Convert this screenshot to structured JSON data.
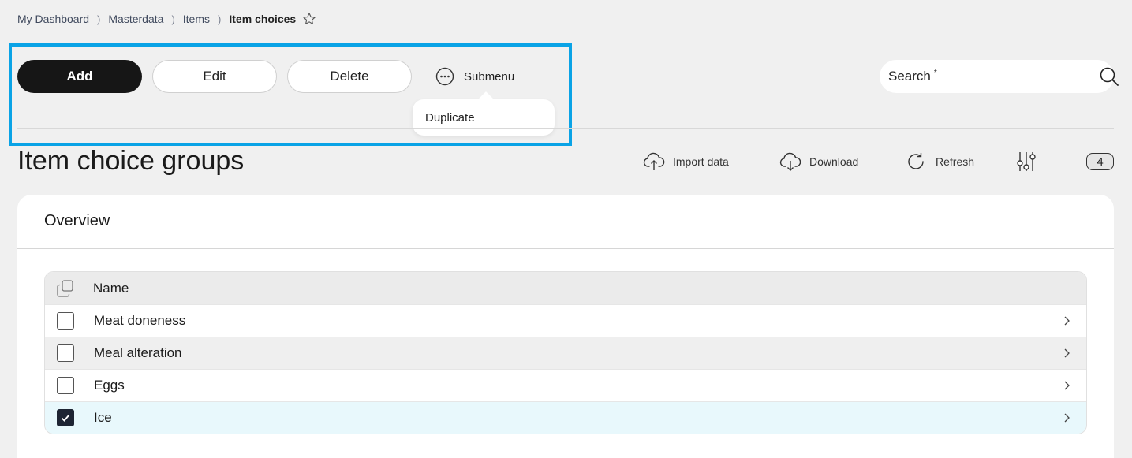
{
  "breadcrumb": {
    "items": [
      "My Dashboard",
      "Masterdata",
      "Items"
    ],
    "current": "Item choices",
    "separator": ")"
  },
  "toolbar": {
    "add_label": "Add",
    "edit_label": "Edit",
    "delete_label": "Delete",
    "submenu_label": "Submenu",
    "submenu_items": [
      "Duplicate"
    ]
  },
  "search": {
    "label": "Search",
    "required_mark": "*",
    "value": ""
  },
  "page": {
    "title": "Item choice groups"
  },
  "actions": {
    "import_label": "Import data",
    "download_label": "Download",
    "refresh_label": "Refresh",
    "count": "4"
  },
  "card": {
    "title": "Overview",
    "table": {
      "header": "Name",
      "rows": [
        {
          "name": "Meat doneness",
          "checked": false
        },
        {
          "name": "Meal alteration",
          "checked": false
        },
        {
          "name": "Eggs",
          "checked": false
        },
        {
          "name": "Ice",
          "checked": true
        }
      ]
    }
  },
  "colors": {
    "highlight": "#0aa3e6",
    "primary_button": "#161616",
    "checkbox_checked": "#1d2433",
    "selected_row": "#e8f8fc"
  }
}
